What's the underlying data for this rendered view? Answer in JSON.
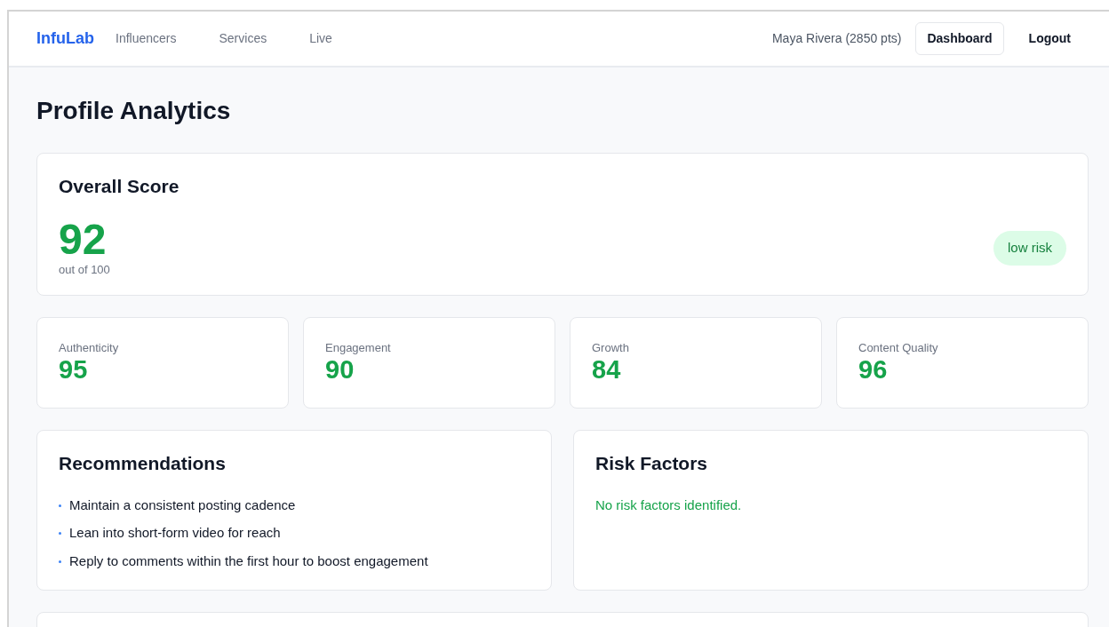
{
  "navbar": {
    "brand": "InfuLab",
    "links": [
      {
        "label": "Influencers"
      },
      {
        "label": "Services"
      },
      {
        "label": "Live"
      }
    ],
    "user": "Maya Rivera (2850 pts)",
    "buttons": [
      {
        "label": "Dashboard",
        "kind": "outlined"
      },
      {
        "label": "Logout",
        "kind": "plain"
      }
    ]
  },
  "page_title": "Profile Analytics",
  "overall": {
    "title": "Overall Score",
    "score": "92",
    "caption": "out of 100",
    "risk_badge": {
      "label": "low risk"
    }
  },
  "metrics": [
    {
      "label": "Authenticity",
      "value": "95"
    },
    {
      "label": "Engagement",
      "value": "90"
    },
    {
      "label": "Growth",
      "value": "84"
    },
    {
      "label": "Content Quality",
      "value": "96"
    }
  ],
  "recommendations": {
    "title": "Recommendations",
    "items": [
      "Maintain a consistent posting cadence",
      "Lean into short-form video for reach",
      "Reply to comments within the first hour to boost engagement"
    ]
  },
  "risk_factors": {
    "title": "Risk Factors",
    "message": "No risk factors identified."
  }
}
